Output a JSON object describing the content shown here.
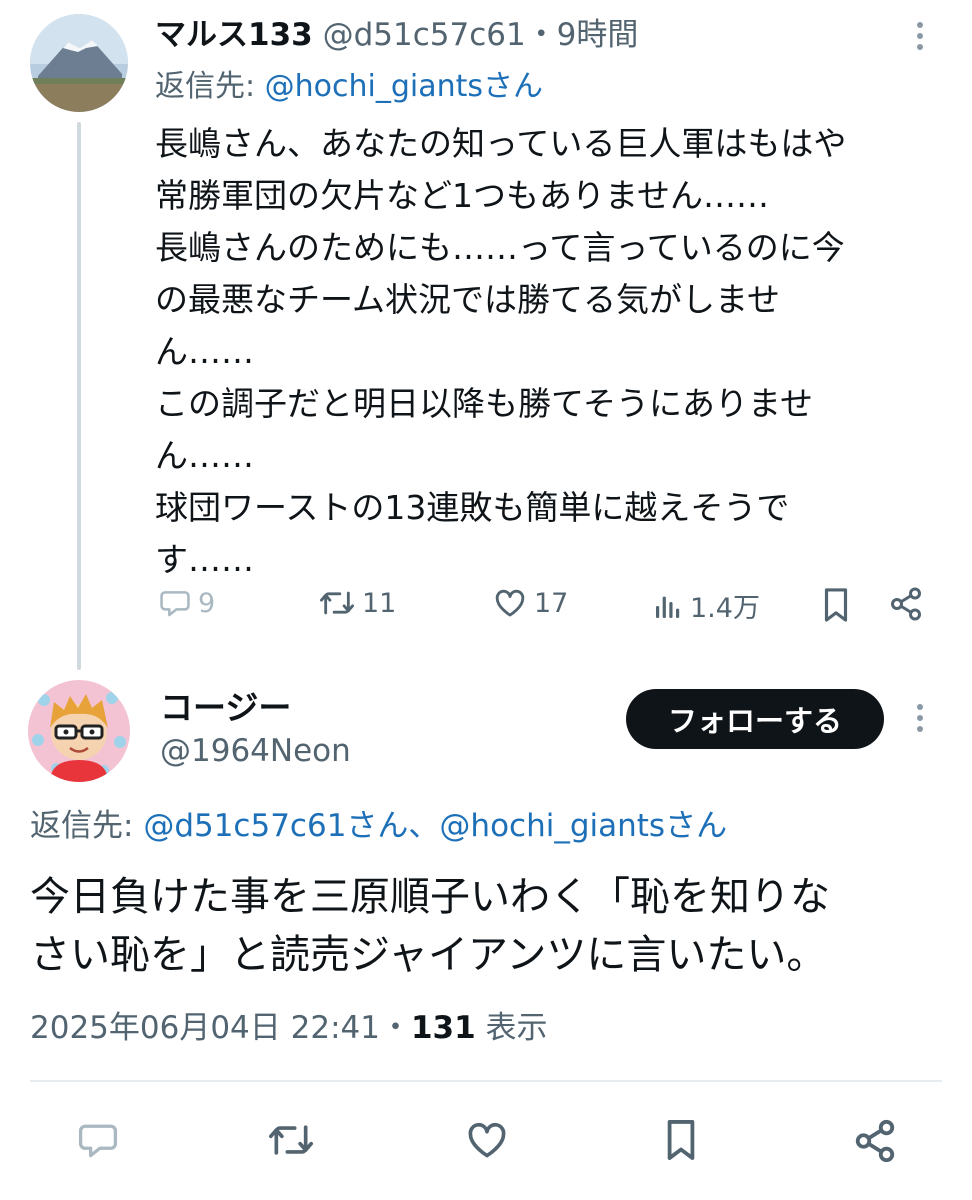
{
  "tweet1": {
    "display_name": "マルス133",
    "handle": "@d51c57c61",
    "time": "・9時間",
    "reply_label": "返信先: ",
    "reply_to": "@hochi_giantsさん",
    "body_lines": [
      "長嶋さん、あなたの知っている巨人軍はもはや",
      "常勝軍団の欠片など1つもありません……",
      "長嶋さんのためにも……って言っているのに今",
      "の最悪なチーム状況では勝てる気がしませ",
      "ん……",
      "この調子だと明日以降も勝てそうにありませ",
      "ん……",
      "球団ワーストの13連敗も簡単に越えそうで",
      "す……"
    ],
    "actions": {
      "reply_count": "9",
      "retweet_count": "11",
      "like_count": "17",
      "views_count": "1.4万"
    }
  },
  "tweet2": {
    "display_name": "コージー",
    "handle": "@1964Neon",
    "follow_label": "フォローする",
    "reply_label": "返信先: ",
    "reply_to": "@d51c57c61さん、@hochi_giantsさん",
    "body_lines": [
      "今日負けた事を三原順子いわく「恥を知りな",
      "さい恥を」と読売ジャイアンツに言いたい。"
    ],
    "date": "2025年06月04日 22:41・",
    "views_number": "131",
    "views_label": " 表示"
  },
  "icons": {
    "more": "more-vertical-icon",
    "reply": "comment-icon",
    "retweet": "retweet-icon",
    "like": "heart-icon",
    "views": "bar-chart-icon",
    "bookmark": "bookmark-icon",
    "share": "share-icon"
  },
  "colors": {
    "link": "#1d70b8",
    "muted": "#536471",
    "text": "#0f1419",
    "follow_bg": "#0f1419"
  }
}
